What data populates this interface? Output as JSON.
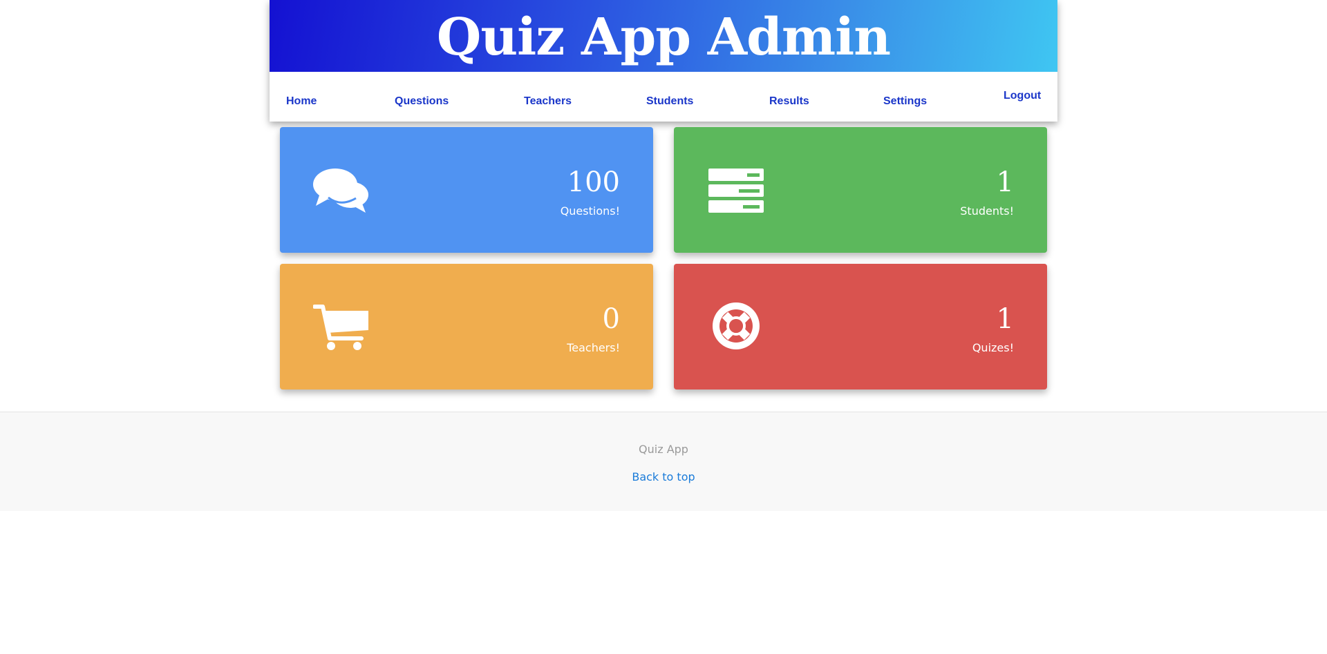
{
  "header": {
    "title": "Quiz App Admin"
  },
  "nav": {
    "home": "Home",
    "questions": "Questions",
    "teachers": "Teachers",
    "students": "Students",
    "results": "Results",
    "settings": "Settings",
    "logout": "Logout"
  },
  "tiles": [
    {
      "count": "100",
      "label": "Questions!",
      "color": "#5093f2",
      "icon": "comments-icon"
    },
    {
      "count": "1",
      "label": "Students!",
      "color": "#5cb85c",
      "icon": "server-icon"
    },
    {
      "count": "0",
      "label": "Teachers!",
      "color": "#f0ad4e",
      "icon": "shopping-cart-icon"
    },
    {
      "count": "1",
      "label": "Quizes!",
      "color": "#d9534f",
      "icon": "life-ring-icon"
    }
  ],
  "footer": {
    "brand": "Quiz App",
    "back_to_top": "Back to top"
  }
}
